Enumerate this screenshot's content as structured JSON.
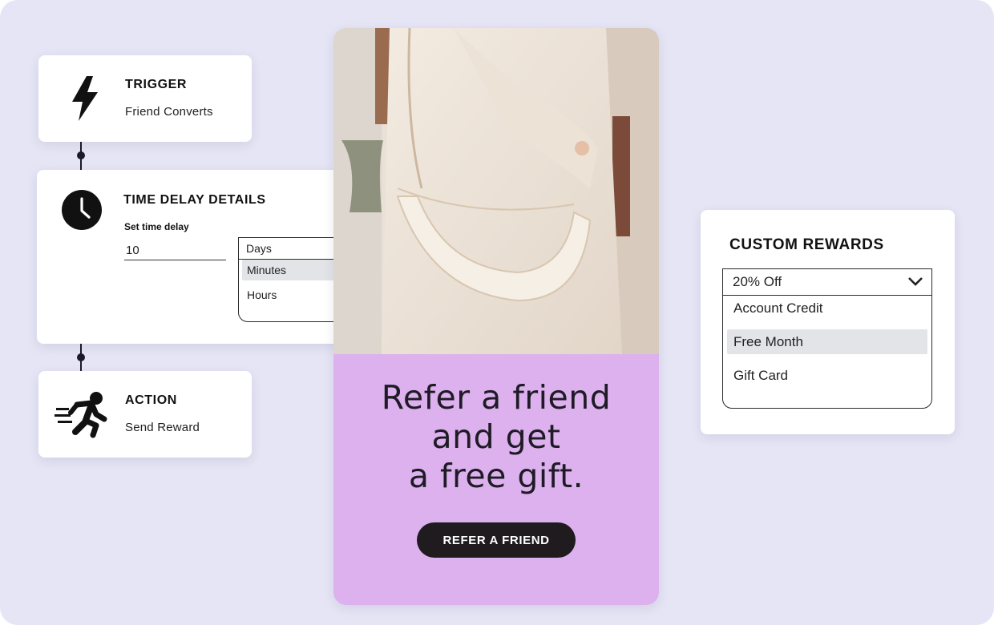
{
  "workflow": {
    "trigger": {
      "title": "TRIGGER",
      "subtitle": "Friend Converts",
      "icon": "lightning-bolt-icon"
    },
    "time_delay": {
      "title": "TIME DELAY DETAILS",
      "icon": "clock-icon",
      "label": "Set time delay",
      "value": "10",
      "unit_selected": "Days",
      "unit_options": [
        "Minutes",
        "Hours"
      ],
      "highlighted_option": "Minutes"
    },
    "action": {
      "title": "ACTION",
      "subtitle": "Send Reward",
      "icon": "running-person-icon"
    }
  },
  "promo": {
    "headline": [
      "Refer a friend",
      "and get",
      "a free gift."
    ],
    "cta_label": "REFER A FRIEND",
    "background_color": "#dcb1ee",
    "photo": "woman-with-cream-shoulder-bag"
  },
  "rewards": {
    "title": "CUSTOM REWARDS",
    "selected": "20% Off",
    "options": [
      "Account Credit",
      "Free Month",
      "Gift Card"
    ],
    "highlighted_option": "Free Month"
  },
  "colors": {
    "background": "#e5e5f5",
    "dark": "#1f1b1f",
    "highlight": "#e3e4e8"
  }
}
